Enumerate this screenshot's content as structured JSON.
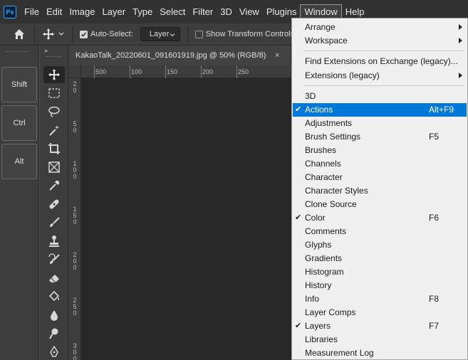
{
  "menubar": {
    "logo": "Ps",
    "items": [
      "File",
      "Edit",
      "Image",
      "Layer",
      "Type",
      "Select",
      "Filter",
      "3D",
      "View",
      "Plugins",
      "Window",
      "Help"
    ],
    "active": "Window"
  },
  "options_bar": {
    "auto_select_label": "Auto-Select:",
    "layer_select": "Layer",
    "show_transform_label": "Show Transform Controls"
  },
  "key_panel": {
    "keys": [
      "Shift",
      "Ctrl",
      "Alt"
    ]
  },
  "toolbar": {
    "collapse_glyph": "»",
    "tools": [
      "move-tool",
      "marquee-tool",
      "lasso-tool",
      "magic-wand-tool",
      "crop-tool",
      "frame-tool",
      "eyedropper-tool",
      "healing-brush-tool",
      "brush-tool",
      "clone-stamp-tool",
      "history-brush-tool",
      "eraser-tool",
      "paint-bucket-tool",
      "blur-tool",
      "dodge-tool",
      "pen-tool"
    ]
  },
  "document": {
    "tab_title": "KakaoTalk_20220601_091601919.jpg @ 50% (RGB/8)",
    "close_glyph": "×",
    "ruler_h_ticks": [
      "500",
      "100",
      "150",
      "200",
      "250"
    ],
    "ruler_v_ticks": [
      "2\n0",
      "5\n0",
      "1\n0\n0",
      "1\n5\n0",
      "2\n0\n0",
      "2\n5\n0",
      "3\n0\n0"
    ]
  },
  "window_menu": {
    "items": [
      {
        "label": "Arrange",
        "shortcut": "",
        "submenu": true,
        "checked": false
      },
      {
        "label": "Workspace",
        "shortcut": "",
        "submenu": true,
        "checked": false
      },
      {
        "label": "Find Extensions on Exchange (legacy)...",
        "shortcut": "",
        "submenu": false,
        "checked": false
      },
      {
        "label": "Extensions (legacy)",
        "shortcut": "",
        "submenu": true,
        "checked": false
      },
      {
        "label": "3D",
        "shortcut": "",
        "submenu": false,
        "checked": false
      },
      {
        "label": "Actions",
        "shortcut": "Alt+F9",
        "submenu": false,
        "checked": true,
        "highlighted": true
      },
      {
        "label": "Adjustments",
        "shortcut": "",
        "submenu": false,
        "checked": false
      },
      {
        "label": "Brush Settings",
        "shortcut": "F5",
        "submenu": false,
        "checked": false
      },
      {
        "label": "Brushes",
        "shortcut": "",
        "submenu": false,
        "checked": false
      },
      {
        "label": "Channels",
        "shortcut": "",
        "submenu": false,
        "checked": false
      },
      {
        "label": "Character",
        "shortcut": "",
        "submenu": false,
        "checked": false
      },
      {
        "label": "Character Styles",
        "shortcut": "",
        "submenu": false,
        "checked": false
      },
      {
        "label": "Clone Source",
        "shortcut": "",
        "submenu": false,
        "checked": false
      },
      {
        "label": "Color",
        "shortcut": "F6",
        "submenu": false,
        "checked": true
      },
      {
        "label": "Comments",
        "shortcut": "",
        "submenu": false,
        "checked": false
      },
      {
        "label": "Glyphs",
        "shortcut": "",
        "submenu": false,
        "checked": false
      },
      {
        "label": "Gradients",
        "shortcut": "",
        "submenu": false,
        "checked": false
      },
      {
        "label": "Histogram",
        "shortcut": "",
        "submenu": false,
        "checked": false
      },
      {
        "label": "History",
        "shortcut": "",
        "submenu": false,
        "checked": false
      },
      {
        "label": "Info",
        "shortcut": "F8",
        "submenu": false,
        "checked": false
      },
      {
        "label": "Layer Comps",
        "shortcut": "",
        "submenu": false,
        "checked": false
      },
      {
        "label": "Layers",
        "shortcut": "F7",
        "submenu": false,
        "checked": true
      },
      {
        "label": "Libraries",
        "shortcut": "",
        "submenu": false,
        "checked": false
      },
      {
        "label": "Measurement Log",
        "shortcut": "",
        "submenu": false,
        "checked": false
      }
    ]
  },
  "colors": {
    "highlight": "#0078d7",
    "ps_blue": "#31a8ff",
    "canvas": "#282828"
  }
}
